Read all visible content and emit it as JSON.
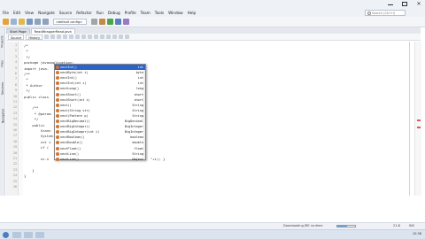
{
  "window": {
    "min_icon": "minimize-icon",
    "max_icon": "maximize-icon",
    "close_label": "✕"
  },
  "menu": [
    "File",
    "Edit",
    "View",
    "Navigate",
    "Source",
    "Refactor",
    "Run",
    "Debug",
    "Profile",
    "Team",
    "Tools",
    "Window",
    "Help"
  ],
  "search": {
    "placeholder": "Search (Ctrl+I)"
  },
  "toolbar": {
    "config": "<default config>",
    "icons": [
      {
        "name": "new-project-icon",
        "color": "#e4a43a"
      },
      {
        "name": "new-file-icon",
        "color": "#9ab4d6"
      },
      {
        "name": "open-project-icon",
        "color": "#e0b84c"
      },
      {
        "name": "save-all-icon",
        "color": "#7a97c2"
      },
      {
        "name": "undo-icon",
        "color": "#8fa3bd"
      },
      {
        "name": "redo-icon",
        "color": "#8fa3bd"
      },
      {
        "name": "build-icon",
        "color": "#a4a4a4"
      },
      {
        "name": "clean-build-icon",
        "color": "#c28b4a"
      },
      {
        "name": "run-icon",
        "color": "#49a64c"
      },
      {
        "name": "debug-icon",
        "color": "#5b7fbe"
      },
      {
        "name": "profile-icon",
        "color": "#9a7bc2"
      }
    ]
  },
  "side_tabs": [
    "Projects",
    "Files",
    "Services",
    "Navigator"
  ],
  "editor": {
    "tabs": [
      "Start Page",
      "ReadWrapperRead.java"
    ],
    "active_tab": 1,
    "view_tabs": [
      "Source",
      "History"
    ],
    "line_numbers": [
      "1",
      "2",
      "3",
      "4",
      "5",
      "6",
      "7",
      "8",
      "9",
      "10",
      "11",
      "12",
      "13",
      "14",
      "15",
      "16",
      "17",
      "18",
      "19",
      "20",
      "21",
      "22",
      "23",
      "24",
      "25",
      "26"
    ],
    "lines": [
      "/*",
      " *",
      " */",
      "package javaapplication;",
      "import java.",
      "/**",
      " *",
      " * Author",
      " */",
      "public class",
      "",
      "    /**",
      "     * @param",
      "     */",
      "    public",
      "        Scann",
      "        System",
      "        int i",
      "        if (",
      "            ",
      "        sc.n",
      "",
      "    }",
      "}",
      "",
      ""
    ],
    "inline_tail": "\"+i); }"
  },
  "completion": {
    "items": [
      {
        "name": "nextInt()",
        "type": "int"
      },
      {
        "name": "nextByte(int i)",
        "type": "byte"
      },
      {
        "name": "nextInt()",
        "type": "int"
      },
      {
        "name": "nextInt(int i)",
        "type": "int"
      },
      {
        "name": "nextLong()",
        "type": "long"
      },
      {
        "name": "nextShort()",
        "type": "short"
      },
      {
        "name": "nextShort(int i)",
        "type": "short"
      },
      {
        "name": "next()",
        "type": "String"
      },
      {
        "name": "next(String str)",
        "type": "String"
      },
      {
        "name": "next(Pattern p)",
        "type": "String"
      },
      {
        "name": "nextBigDecimal()",
        "type": "BigDecimal"
      },
      {
        "name": "nextBigInteger()",
        "type": "BigInteger"
      },
      {
        "name": "nextBigInteger(int i)",
        "type": "BigInteger"
      },
      {
        "name": "nextBoolean()",
        "type": "boolean"
      },
      {
        "name": "nextDouble()",
        "type": "double"
      },
      {
        "name": "nextFloat()",
        "type": "float"
      },
      {
        "name": "nextLine()",
        "type": "String"
      },
      {
        "name": "nextLine()",
        "type": "Object"
      }
    ],
    "selected_index": 0
  },
  "status": {
    "progress_text": "Downloading JRE runtime",
    "progress_fraction": 0.55,
    "caret": "21:8",
    "mode": "INS"
  },
  "taskbar": {
    "time": "10:38",
    "buttons": [
      "explorer-task",
      "browser-task",
      "netbeans-task"
    ]
  }
}
